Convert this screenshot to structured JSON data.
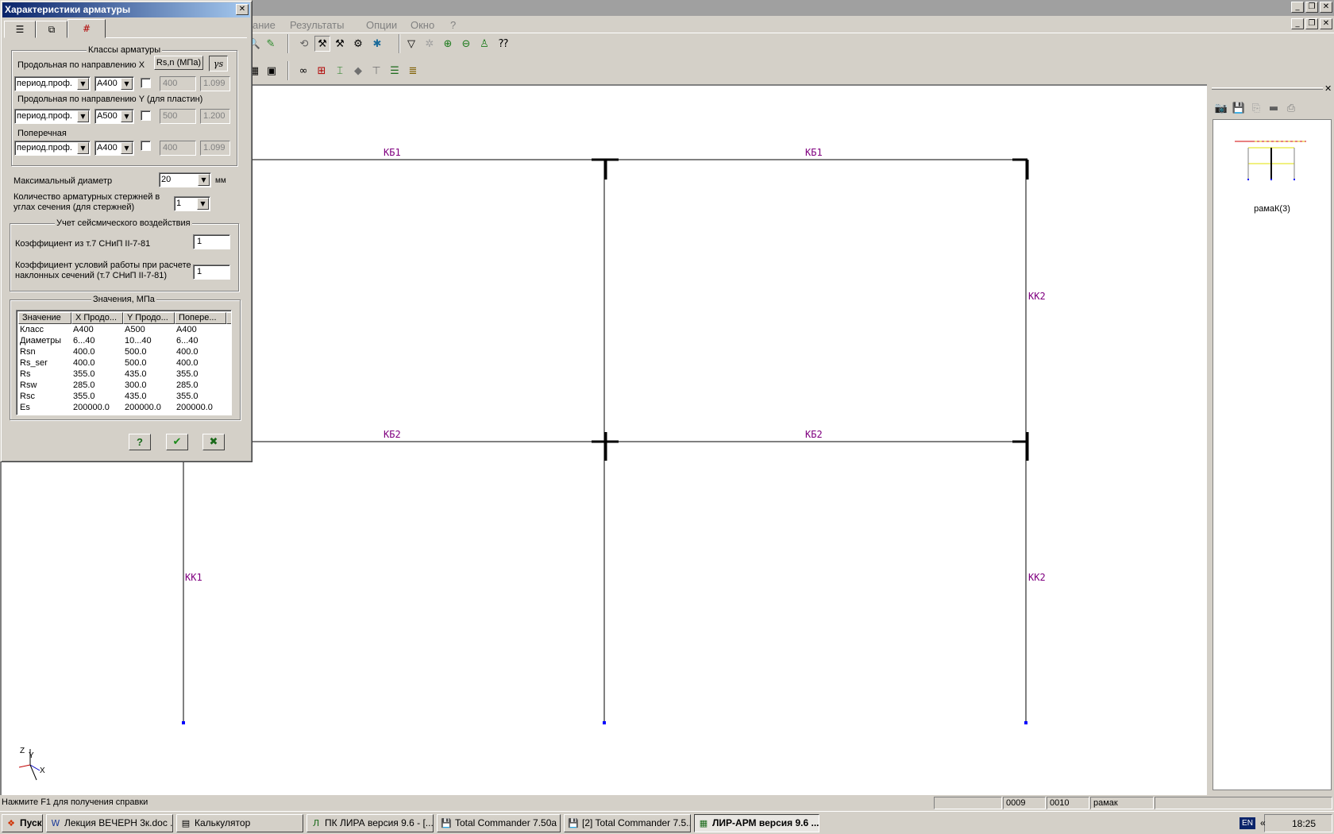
{
  "menu": {
    "items": [
      "ание",
      "Результаты",
      "Опции",
      "Окно",
      "?"
    ]
  },
  "drawing": {
    "labels": {
      "kb1_left": "КБ1",
      "kb1_right": "КБ1",
      "kb2_left": "КБ2",
      "kb2_right": "КБ2",
      "kk2_upper": "КК2",
      "kk1": "КК1",
      "kk2_lower": "КК2"
    },
    "axes": {
      "z": "Z",
      "y": "Y",
      "x": "X"
    },
    "colors": {
      "frame": "#000000",
      "labels": "#800080",
      "nodes": "#0000ff"
    }
  },
  "side_panel": {
    "preview_caption": "рамаК(3)"
  },
  "statusbar": {
    "help": "Нажмите F1 для получения справки",
    "cell2": "0009",
    "cell3": "0010",
    "cell4": "рамак"
  },
  "taskbar": {
    "start": "Пуск",
    "items": [
      "Лекция ВЕЧЕРН 3к.doc ...",
      "Калькулятор",
      "ПК ЛИРА  версия 9.6 - [...",
      "Total Commander 7.50a ...",
      "[2] Total Commander 7.5...",
      "ЛИР-АРМ версия 9.6  ..."
    ],
    "lang": "EN",
    "clock": "18:25"
  },
  "dialog": {
    "title": "Характеристики арматуры",
    "reinf_classes": {
      "group_title": "Классы арматуры",
      "longitudinal_x": "Продольная по направлению X",
      "longitudinal_y": "Продольная по направлению Y (для пластин)",
      "transverse": "Поперечная",
      "rsn_button": "Rs,n (МПа)",
      "gamma_button": "γs",
      "rows": [
        {
          "type": "период.проф.",
          "cls": "А400",
          "rsn": "400",
          "gamma": "1.099"
        },
        {
          "type": "период.проф.",
          "cls": "А500",
          "rsn": "500",
          "gamma": "1.200"
        },
        {
          "type": "период.проф.",
          "cls": "А400",
          "rsn": "400",
          "gamma": "1.099"
        }
      ]
    },
    "max_diameter_label": "Максимальный диаметр",
    "max_diameter_value": "20",
    "max_diameter_unit": "мм",
    "bars_in_corners_label_1": "Количество арматурных стержней в",
    "bars_in_corners_label_2": "углах сечения (для стержней)",
    "bars_in_corners_value": "1",
    "seismic": {
      "group_title": "Учет сейсмического  воздействия",
      "coef1_label": "Коэффициент из т.7 СНиП II-7-81",
      "coef1_value": "1",
      "coef2_label_1": "Коэффициент условий работы при расчете",
      "coef2_label_2": "наклонных сечений (т.7 СНиП II-7-81)",
      "coef2_value": "1"
    },
    "values": {
      "group_title": "Значения, МПа",
      "headers": [
        "Значение",
        "X Продо...",
        "Y Продо...",
        "Попере..."
      ],
      "rows": [
        [
          "Класс",
          "А400",
          "А500",
          "А400"
        ],
        [
          "Диаметры",
          "6...40",
          "10...40",
          "6...40"
        ],
        [
          "Rsn",
          "400.0",
          "500.0",
          "400.0"
        ],
        [
          "Rs_ser",
          "400.0",
          "500.0",
          "400.0"
        ],
        [
          "Rs",
          "355.0",
          "435.0",
          "355.0"
        ],
        [
          "Rsw",
          "285.0",
          "300.0",
          "285.0"
        ],
        [
          "Rsc",
          "355.0",
          "435.0",
          "355.0"
        ],
        [
          "Es",
          "200000.0",
          "200000.0",
          "200000.0"
        ]
      ]
    }
  }
}
